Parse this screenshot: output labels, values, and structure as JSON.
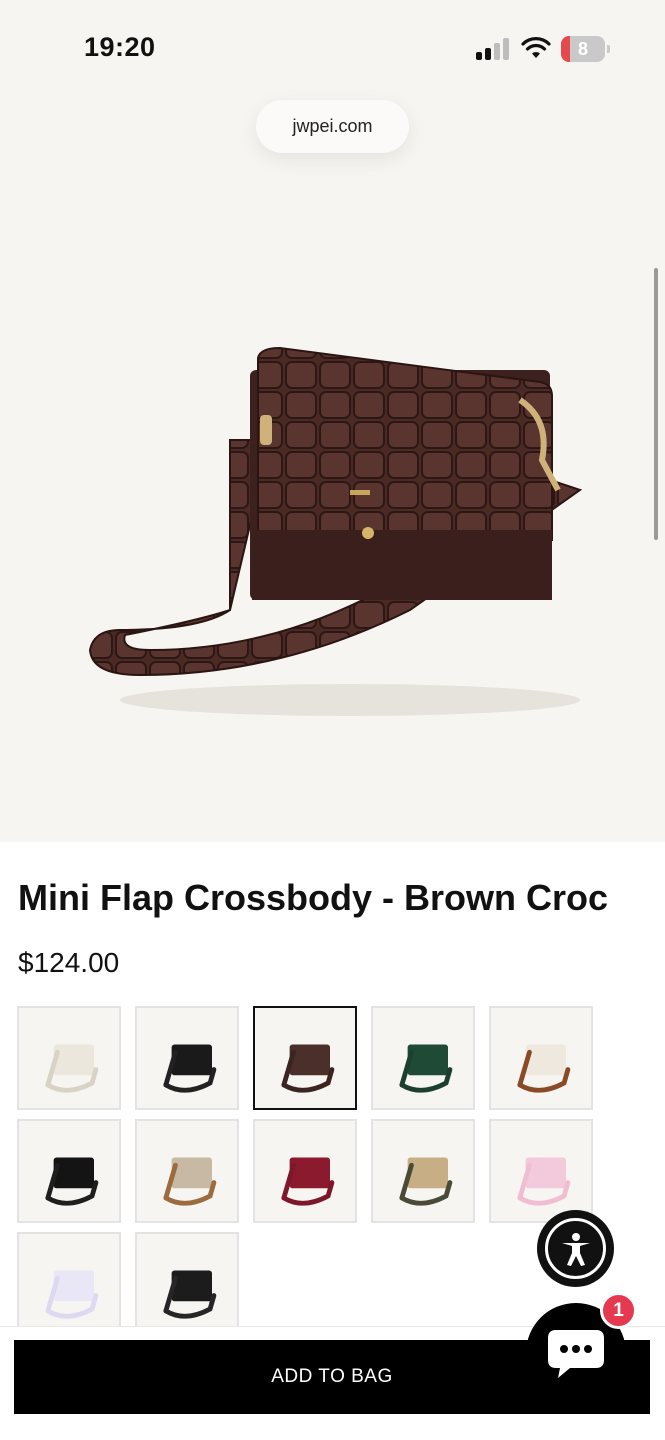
{
  "status_bar": {
    "time": "19:20",
    "battery_level": "8",
    "battery_color": "#e5484d"
  },
  "browser": {
    "url": "jwpei.com"
  },
  "product": {
    "image_icon": "brown-croc-crossbody-bag-photo",
    "title": "Mini Flap Crossbody - Brown Croc",
    "price": "$124.00"
  },
  "swatches": [
    {
      "name": "ivory",
      "color": "#ece7dc",
      "strap": "#d9d3c6",
      "selected": false
    },
    {
      "name": "black",
      "color": "#1a1a1a",
      "strap": "#222222",
      "selected": false
    },
    {
      "name": "brown-croc",
      "color": "#4a2f2a",
      "strap": "#3c2420",
      "selected": true
    },
    {
      "name": "dark-green",
      "color": "#1f4a36",
      "strap": "#1c3f2e",
      "selected": false
    },
    {
      "name": "cream-brown",
      "color": "#efe8df",
      "strap": "#8a4a26",
      "selected": false
    },
    {
      "name": "black-2",
      "color": "#141414",
      "strap": "#1e1e1e",
      "selected": false
    },
    {
      "name": "monogram-tan",
      "color": "#c7b9a4",
      "strap": "#9c6b3e",
      "selected": false
    },
    {
      "name": "burgundy",
      "color": "#8c1a2f",
      "strap": "#7e1729",
      "selected": false
    },
    {
      "name": "tan-olive",
      "color": "#c7ae85",
      "strap": "#4b4a36",
      "selected": false
    },
    {
      "name": "pink",
      "color": "#f3c9dc",
      "strap": "#f1bdd2",
      "selected": false
    },
    {
      "name": "lilac",
      "color": "#e9e7f6",
      "strap": "#dcd9f1",
      "selected": false
    },
    {
      "name": "black-monogram",
      "color": "#1c1c1c",
      "strap": "#262626",
      "selected": false
    }
  ],
  "actions": {
    "add_to_bag": "ADD TO BAG"
  },
  "chat": {
    "badge_count": "1"
  },
  "colors": {
    "accent": "#000000",
    "badge": "#e53950",
    "hero_bg": "#f7f5f1"
  }
}
